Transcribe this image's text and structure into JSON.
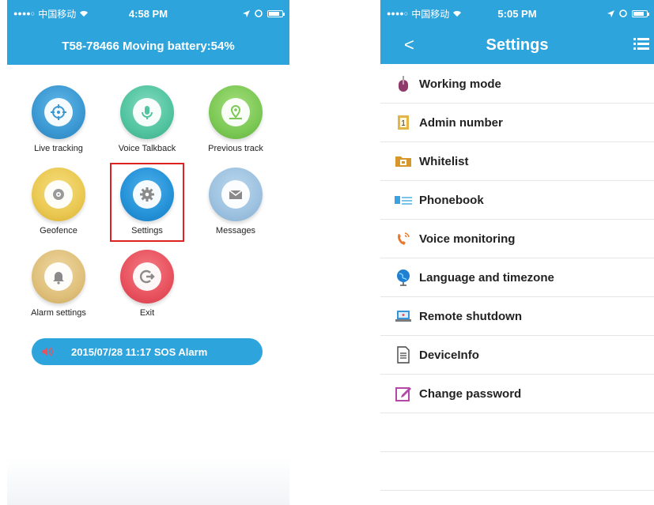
{
  "left": {
    "status": {
      "carrier": "中国移动",
      "time": "4:58 PM"
    },
    "header": {
      "title": "T58-78466 Moving battery:54%"
    },
    "tiles": [
      {
        "label": "Live tracking"
      },
      {
        "label": "Voice Talkback"
      },
      {
        "label": "Previous track"
      },
      {
        "label": "Geofence"
      },
      {
        "label": "Settings"
      },
      {
        "label": "Messages"
      },
      {
        "label": "Alarm settings"
      },
      {
        "label": "Exit"
      }
    ],
    "alarm": {
      "text": "2015/07/28 11:17 SOS Alarm"
    }
  },
  "right": {
    "status": {
      "carrier": "中国移动",
      "time": "5:05 PM"
    },
    "header": {
      "title": "Settings",
      "back": "<"
    },
    "items": [
      {
        "label": "Working mode"
      },
      {
        "label": "Admin number"
      },
      {
        "label": "Whitelist"
      },
      {
        "label": "Phonebook"
      },
      {
        "label": "Voice monitoring"
      },
      {
        "label": "Language and timezone"
      },
      {
        "label": "Remote shutdown"
      },
      {
        "label": "DeviceInfo"
      },
      {
        "label": "Change password"
      }
    ]
  },
  "colors": {
    "accent": "#2ea4dd",
    "highlight": "#dd2222"
  },
  "icons": [
    "crosshair-icon",
    "microphone-icon",
    "map-pin-icon",
    "target-icon",
    "gear-icon",
    "envelope-icon",
    "bell-icon",
    "exit-icon",
    "speaker-icon",
    "mouse-icon",
    "phone-card-icon",
    "folder-icon",
    "list-icon",
    "headset-icon",
    "globe-icon",
    "laptop-icon",
    "document-icon",
    "edit-icon",
    "hamburger-menu-icon"
  ]
}
